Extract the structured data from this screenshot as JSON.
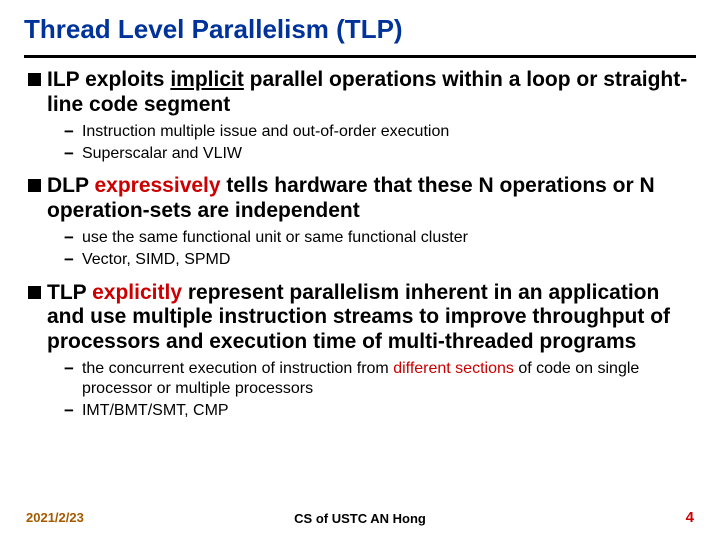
{
  "title": "Thread Level Parallelism (TLP)",
  "bullets": {
    "b1": {
      "pre": "ILP exploits ",
      "underlined": "implicit",
      "post": " parallel operations within a loop or straight-line code segment",
      "sub1": "Instruction multiple issue and out-of-order execution",
      "sub2": "Superscalar and VLIW"
    },
    "b2": {
      "pre": "DLP ",
      "accent": "expressively",
      "post": " tells hardware that these N operations or N operation-sets are independent",
      "sub1": "use the same functional unit or same functional cluster",
      "sub2": "Vector, SIMD, SPMD"
    },
    "b3": {
      "pre": "TLP ",
      "accent": "explicitly",
      "post": " represent parallelism inherent in an application and use multiple instruction streams to improve throughput of processors and execution time of multi-threaded programs",
      "sub1_pre": "the concurrent execution of instruction from ",
      "sub1_accent": "different sections",
      "sub1_post": " of code on single processor or multiple processors",
      "sub2": "IMT/BMT/SMT, CMP"
    }
  },
  "footer": {
    "date": "2021/2/23",
    "center": "CS of USTC AN Hong",
    "page": "4"
  }
}
